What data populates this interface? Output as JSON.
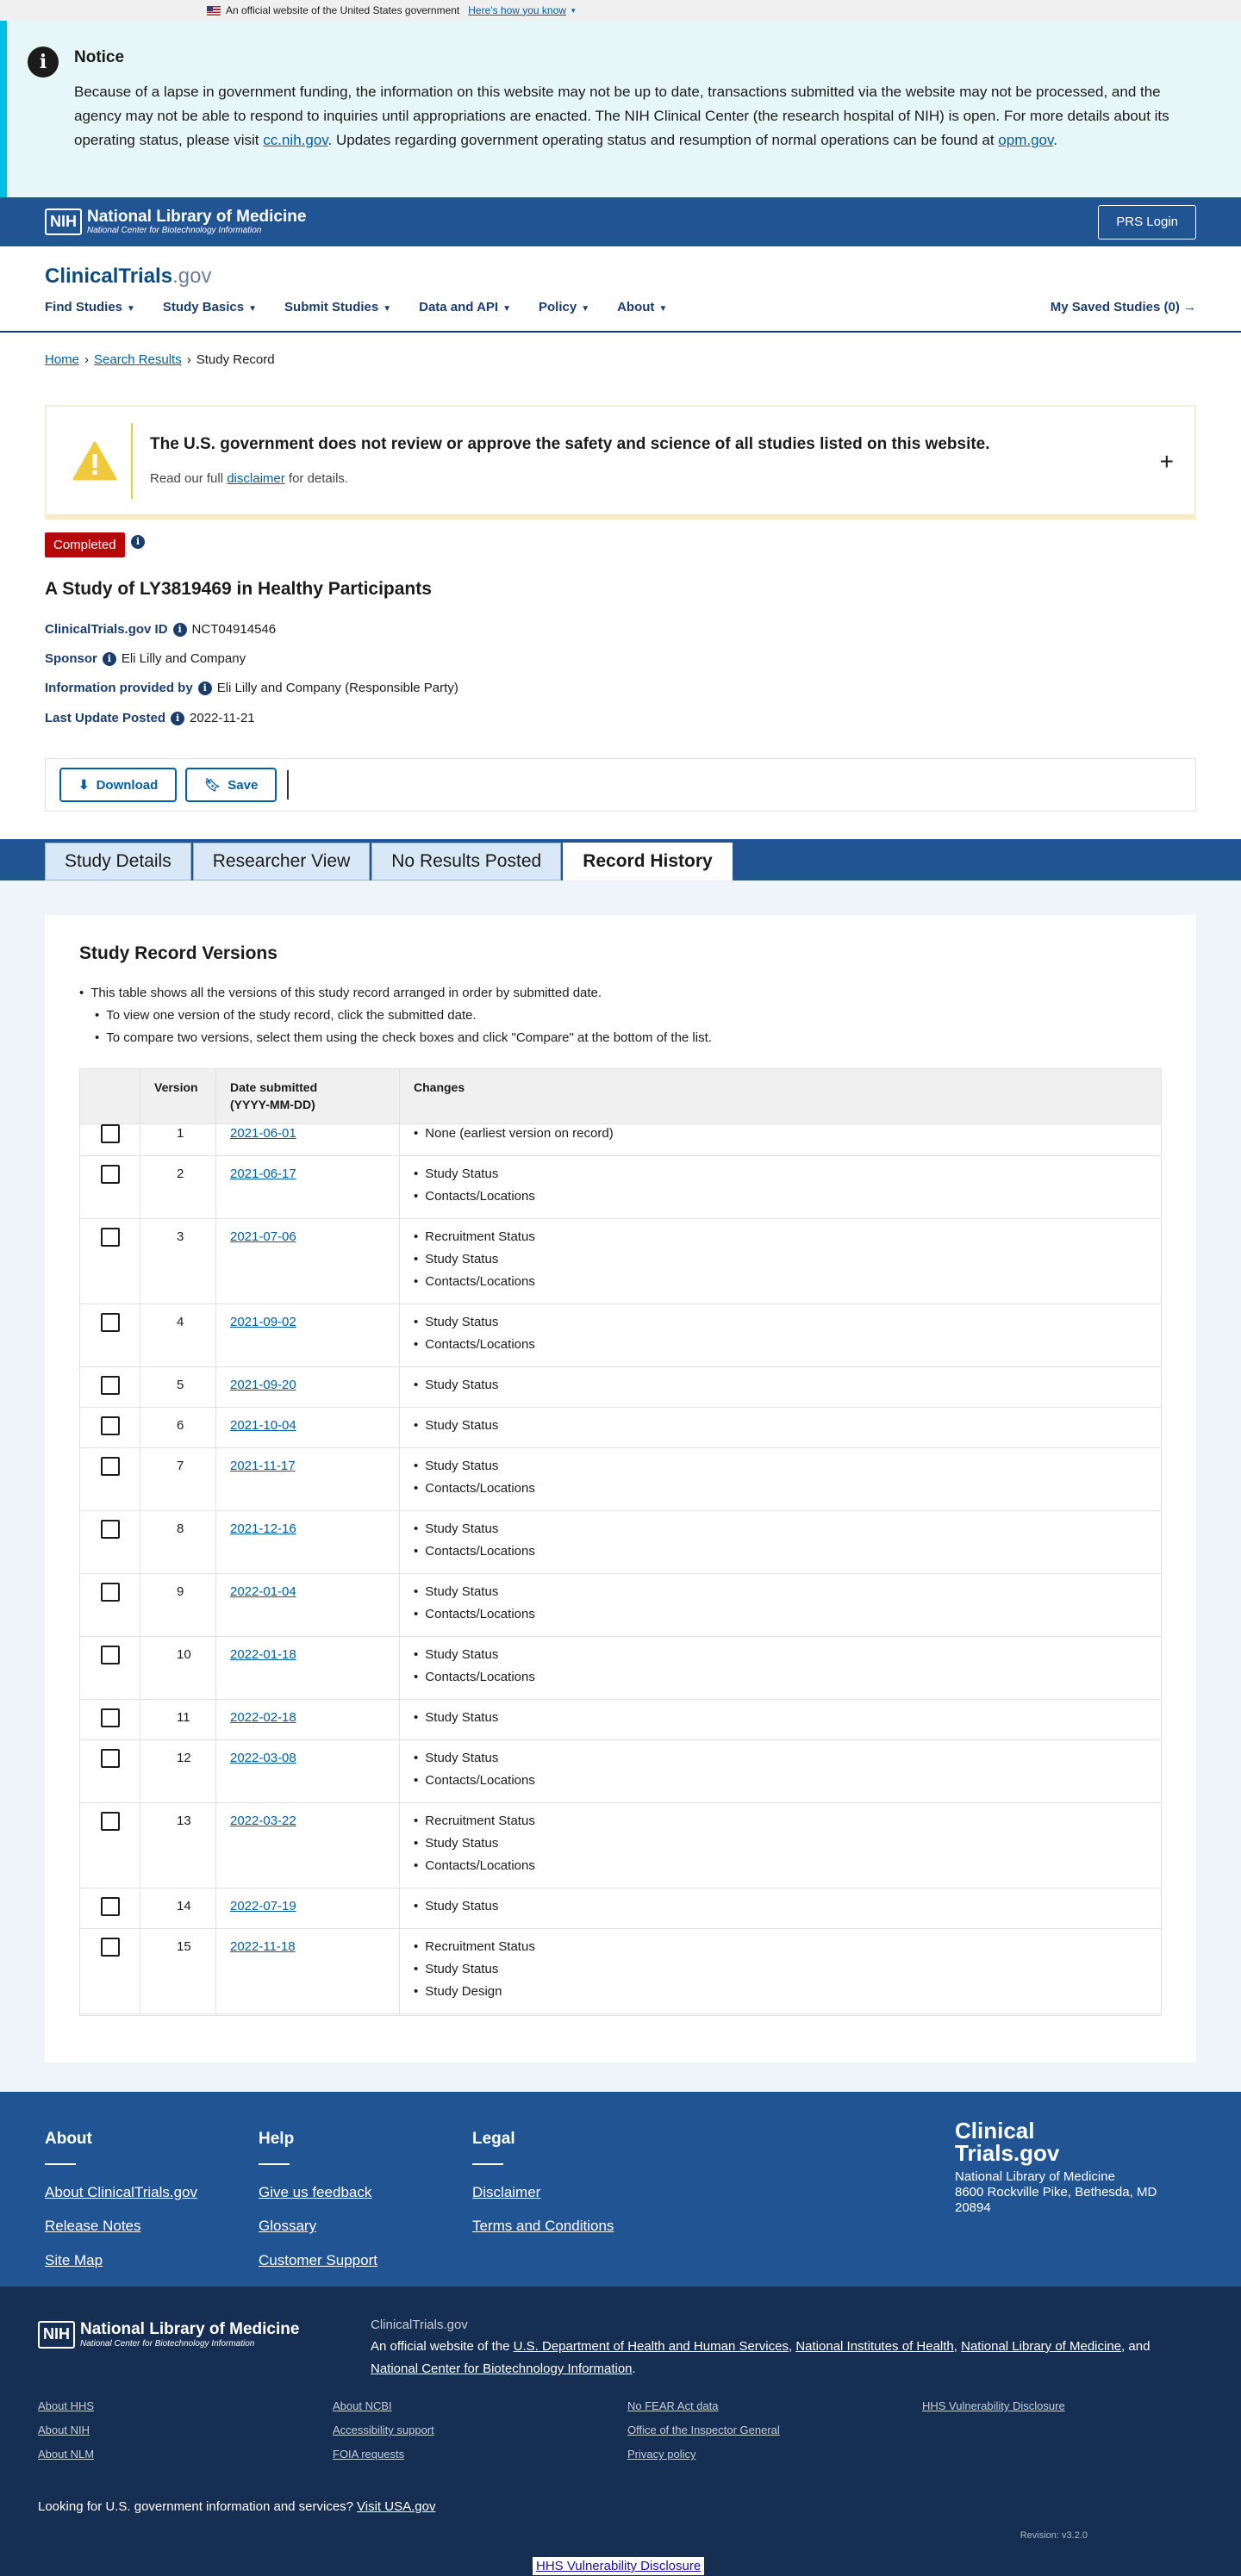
{
  "gov_banner": {
    "text": "An official website of the United States government",
    "link": "Here's how you know"
  },
  "notice": {
    "title": "Notice",
    "body_pre": "Because of a lapse in government funding, the information on this website may not be up to date, transactions submitted via the website may not be processed, and the agency may not be able to respond to inquiries until appropriations are enacted. The NIH Clinical Center (the research hospital of NIH) is open. For more details about its operating status, please visit ",
    "link1": "cc.nih.gov",
    "body_mid": ". Updates regarding government operating status and resumption of normal operations can be found at ",
    "link2": "opm.gov",
    "body_end": "."
  },
  "nlm": {
    "nih": "NIH",
    "title": "National Library of Medicine",
    "subtitle": "National Center for Biotechnology Information",
    "prs_login": "PRS Login"
  },
  "header": {
    "brand": "ClinicalTrials",
    "brand_suffix": ".gov",
    "nav": [
      "Find Studies",
      "Study Basics",
      "Submit Studies",
      "Data and API",
      "Policy",
      "About"
    ],
    "saved": "My Saved Studies (0)"
  },
  "breadcrumb": {
    "home": "Home",
    "results": "Search Results",
    "current": "Study Record"
  },
  "disclaimer": {
    "heading": "The U.S. government does not review or approve the safety and science of all studies listed on this website.",
    "pre": "Read our full ",
    "link": "disclaimer",
    "post": " for details."
  },
  "study": {
    "status": "Completed",
    "title": "A Study of LY3819469 in Healthy Participants",
    "id_label": "ClinicalTrials.gov ID",
    "id": "NCT04914546",
    "sponsor_label": "Sponsor",
    "sponsor": "Eli Lilly and Company",
    "info_label": "Information provided by",
    "info": "Eli Lilly and Company (Responsible Party)",
    "updated_label": "Last Update Posted",
    "updated": "2022-11-21"
  },
  "actions": {
    "download": "Download",
    "save": "Save"
  },
  "tabs": [
    "Study Details",
    "Researcher View",
    "No Results Posted",
    "Record History"
  ],
  "versions": {
    "title": "Study Record Versions",
    "notes": [
      "This table shows all the versions of this study record arranged in order by submitted date.",
      "To view one version of the study record, click the submitted date.",
      "To compare two versions, select them using the check boxes and click \"Compare\" at the bottom of the list."
    ],
    "headers": {
      "version": "Version",
      "date1": "Date submitted",
      "date2": "(YYYY-MM-DD)",
      "changes": "Changes"
    },
    "rows": [
      {
        "v": "1",
        "date": "2021-06-01",
        "changes": [
          "None (earliest version on record)"
        ]
      },
      {
        "v": "2",
        "date": "2021-06-17",
        "changes": [
          "Study Status",
          "Contacts/Locations"
        ]
      },
      {
        "v": "3",
        "date": "2021-07-06",
        "changes": [
          "Recruitment Status",
          "Study Status",
          "Contacts/Locations"
        ]
      },
      {
        "v": "4",
        "date": "2021-09-02",
        "changes": [
          "Study Status",
          "Contacts/Locations"
        ]
      },
      {
        "v": "5",
        "date": "2021-09-20",
        "changes": [
          "Study Status"
        ]
      },
      {
        "v": "6",
        "date": "2021-10-04",
        "changes": [
          "Study Status"
        ]
      },
      {
        "v": "7",
        "date": "2021-11-17",
        "changes": [
          "Study Status",
          "Contacts/Locations"
        ]
      },
      {
        "v": "8",
        "date": "2021-12-16",
        "changes": [
          "Study Status",
          "Contacts/Locations"
        ]
      },
      {
        "v": "9",
        "date": "2022-01-04",
        "changes": [
          "Study Status",
          "Contacts/Locations"
        ]
      },
      {
        "v": "10",
        "date": "2022-01-18",
        "changes": [
          "Study Status",
          "Contacts/Locations"
        ]
      },
      {
        "v": "11",
        "date": "2022-02-18",
        "changes": [
          "Study Status"
        ]
      },
      {
        "v": "12",
        "date": "2022-03-08",
        "changes": [
          "Study Status",
          "Contacts/Locations"
        ]
      },
      {
        "v": "13",
        "date": "2022-03-22",
        "changes": [
          "Recruitment Status",
          "Study Status",
          "Contacts/Locations"
        ]
      },
      {
        "v": "14",
        "date": "2022-07-19",
        "changes": [
          "Study Status"
        ]
      },
      {
        "v": "15",
        "date": "2022-11-18",
        "changes": [
          "Recruitment Status",
          "Study Status",
          "Study Design"
        ]
      }
    ]
  },
  "footer": {
    "about": {
      "title": "About",
      "links": [
        "About ClinicalTrials.gov",
        "Release Notes",
        "Site Map"
      ]
    },
    "help": {
      "title": "Help",
      "links": [
        "Give us feedback",
        "Glossary",
        "Customer Support"
      ]
    },
    "legal": {
      "title": "Legal",
      "links": [
        "Disclaimer",
        "Terms and Conditions"
      ]
    },
    "brand1": "Clinical",
    "brand2": "Trials.gov",
    "org": "National Library of Medicine",
    "addr1": "8600 Rockville Pike, Bethesda, MD",
    "addr2": "20894"
  },
  "footer_bottom": {
    "ct": "ClinicalTrials.gov",
    "official_pre": "An official website of the ",
    "hhs": "U.S. Department of Health and Human Services",
    "nih": "National Institutes of Health",
    "nlm": "National Library of Medicine",
    "and": "and ",
    "ncbi": "National Center for Biotechnology Information",
    "links": [
      "About HHS",
      "About NCBI",
      "No FEAR Act data",
      "HHS Vulnerability Disclosure",
      "About NIH",
      "Accessibility support",
      "Office of the Inspector General",
      "About NLM",
      "FOIA requests",
      "Privacy policy"
    ],
    "usa_pre": "Looking for U.S. government information and services?",
    "usa_link": "Visit USA.gov",
    "revision": "Revision: v3.2.0",
    "hhs_bottom": "HHS Vulnerability Disclosure"
  }
}
